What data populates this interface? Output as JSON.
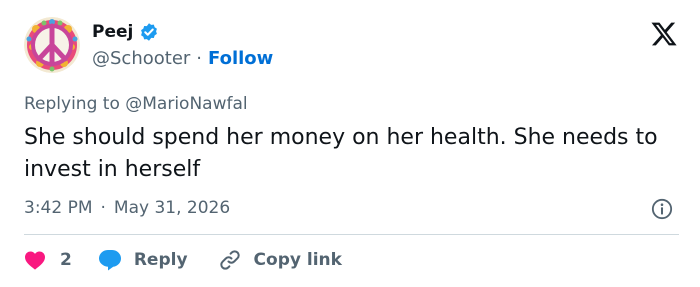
{
  "author": {
    "name": "Peej",
    "handle": "@Schooter",
    "separator": "·",
    "follow_label": "Follow"
  },
  "reply_to": {
    "prefix": "Replying to",
    "mention": "@MarioNawfal"
  },
  "tweet": {
    "text": "She should spend her money on her health. She needs to invest in herself"
  },
  "meta": {
    "time": "3:42 PM",
    "separator": "·",
    "date": "May 31, 2026"
  },
  "actions": {
    "like_count": "2",
    "reply_label": "Reply",
    "copy_label": "Copy link"
  },
  "colors": {
    "accent": "#006fd6",
    "like": "#f91880",
    "reply_icon": "#1d9bf0",
    "muted": "#536471",
    "text": "#0f1419"
  },
  "icons": [
    "peace-sign-avatar",
    "verified-badge-icon",
    "x-logo-icon",
    "info-icon",
    "heart-icon",
    "reply-bubble-icon",
    "link-icon"
  ]
}
